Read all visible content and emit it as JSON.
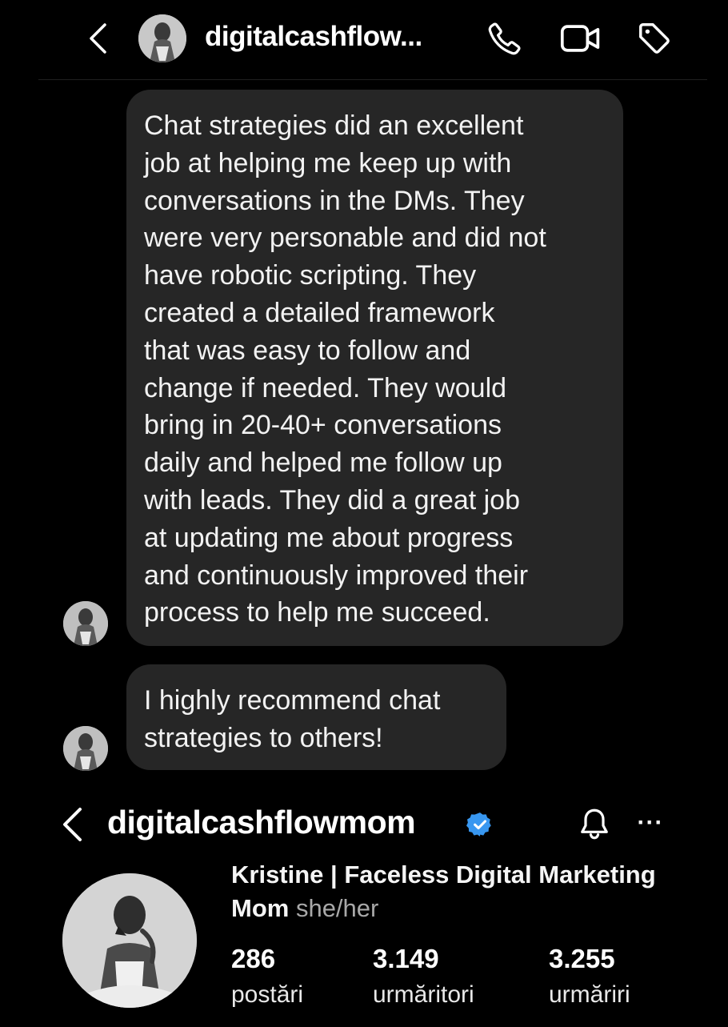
{
  "chat_header": {
    "username": "digitalcashflow...",
    "back_icon": "chevron-left-icon",
    "call_icon": "phone-icon",
    "video_icon": "video-camera-icon",
    "tag_icon": "tag-icon"
  },
  "messages": [
    {
      "text": "Chat strategies did an excellent\njob at helping me keep up with\nconversations in the DMs. They\nwere very personable and did not\nhave robotic scripting. They\ncreated a detailed framework\nthat was easy to follow and\nchange if needed. They would\nbring in 20-40+ conversations\ndaily and helped me follow up\nwith leads. They did a great job\nat updating me about progress\nand continuously improved their\nprocess to help me succeed."
    },
    {
      "text": "I highly recommend chat\nstrategies to others!"
    }
  ],
  "profile": {
    "username": "digitalcashflowmom",
    "verified_color": "#3897f0",
    "display_name": "Kristine | Faceless Digital Marketing Mom",
    "pronouns": "she/her",
    "more_label": "···",
    "stats": [
      {
        "value": "286",
        "label": "postări"
      },
      {
        "value": "3.149",
        "label": "urmăritori"
      },
      {
        "value": "3.255",
        "label": "urmăriri"
      }
    ]
  },
  "colors": {
    "background": "#000000",
    "bubble": "#262626",
    "text": "#ffffff",
    "muted": "#a8a8a8"
  }
}
